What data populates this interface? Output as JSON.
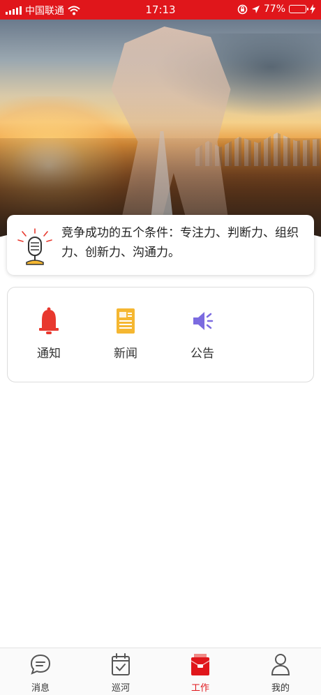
{
  "status_bar": {
    "carrier": "中国联通",
    "time": "17:13",
    "battery": "77%",
    "battery_level": 0.77,
    "icons": [
      "signal-icon",
      "wifi-icon",
      "lock-rotation-icon",
      "location-icon",
      "battery-icon",
      "charging-icon"
    ]
  },
  "banner": {
    "image": "handshake-over-city-road-sunset"
  },
  "notice": {
    "icon": "microphone-icon",
    "text": "竞争成功的五个条件：专注力、判断力、组织力、创新力、沟通力。"
  },
  "quick_menu": {
    "items": [
      {
        "label": "通知",
        "icon": "bell-icon",
        "color": "#e8382e"
      },
      {
        "label": "新闻",
        "icon": "news-document-icon",
        "color": "#f5b731"
      },
      {
        "label": "公告",
        "icon": "speaker-icon",
        "color": "#7b6be0"
      }
    ]
  },
  "tab_bar": {
    "active_color": "#e0161b",
    "items": [
      {
        "label": "消息",
        "icon": "message-icon",
        "active": false
      },
      {
        "label": "巡河",
        "icon": "calendar-check-icon",
        "active": false
      },
      {
        "label": "工作",
        "icon": "work-folder-icon",
        "active": true
      },
      {
        "label": "我的",
        "icon": "user-icon",
        "active": false
      }
    ]
  }
}
